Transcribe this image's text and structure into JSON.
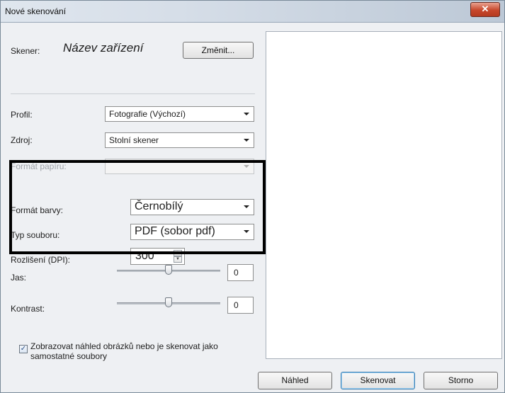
{
  "window": {
    "title": "Nové skenování",
    "close_glyph": "✕"
  },
  "scanner": {
    "label": "Skener:",
    "device": "Název zařízení",
    "change_label": "Změnit..."
  },
  "profile": {
    "label": "Profil:",
    "value": "Fotografie (Výchozí)"
  },
  "source": {
    "label": "Zdroj:",
    "value": "Stolní skener"
  },
  "paper_size": {
    "label": "Formát papíru:",
    "value": ""
  },
  "color_format": {
    "label": "Formát barvy:",
    "value": "Černobílý"
  },
  "file_type": {
    "label": "Typ souboru:",
    "value": "PDF (sobor pdf)"
  },
  "resolution": {
    "label": "Rozlišení (DPI):",
    "value": "300"
  },
  "brightness": {
    "label": "Jas:",
    "value": "0",
    "level_fraction": 0.5
  },
  "contrast": {
    "label": "Kontrast:",
    "value": "0",
    "level_fraction": 0.5
  },
  "separate_files": {
    "checked": true,
    "check_glyph": "✓",
    "label": "Zobrazovat náhled obrázků nebo je skenovat jako samostatné soubory"
  },
  "buttons": {
    "preview": "Náhled",
    "scan": "Skenovat",
    "cancel": "Storno"
  },
  "icons": {
    "dropdown": "chevron-down-icon",
    "spin": "spin-arrows-icon",
    "close": "close-icon"
  }
}
